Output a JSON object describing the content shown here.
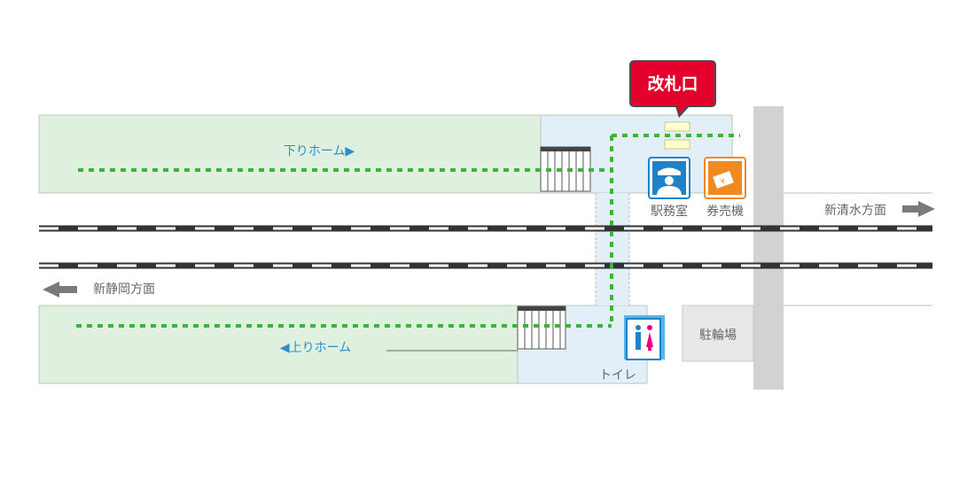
{
  "map": {
    "ticket_gate": "改札口",
    "down_platform": "下りホーム▶",
    "up_platform": "◀上りホーム",
    "station_office": "駅務室",
    "ticket_machine": "券売機",
    "toilet": "トイレ",
    "bicycle_parking": "駐輪場",
    "direction_east": "新清水方面",
    "direction_west": "新静岡方面"
  },
  "colors": {
    "platform": "#dff0df",
    "concourse": "#e3eff8",
    "route": "#3cb43c",
    "gate_badge": "#e3002d",
    "office_icon": "#1e82c8",
    "ticket_icon": "#f08a1e",
    "label_blue": "#2a8fc8"
  },
  "icons": {
    "office": "station-staff-icon",
    "ticket": "ticket-machine-icon",
    "toilet": "restroom-icon",
    "arrow_east": "arrow-right-icon",
    "arrow_west": "arrow-left-icon"
  }
}
